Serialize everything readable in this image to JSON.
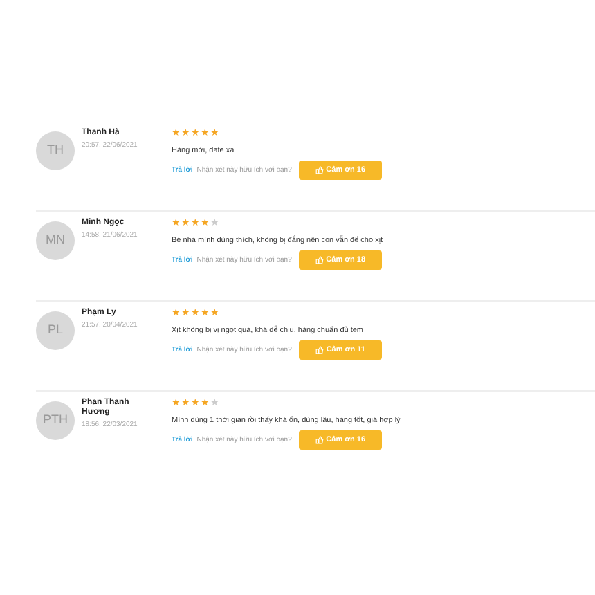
{
  "reviews": [
    {
      "initials": "TH",
      "name": "Thanh Hà",
      "time": "20:57, 22/06/2021",
      "stars": 5,
      "comment": "Hàng mới, date xa",
      "reply": "Trả lời",
      "question": "Nhận xét này hữu ích với bạn?",
      "thanks": "Cảm ơn 16"
    },
    {
      "initials": "MN",
      "name": "Minh Ngọc",
      "time": "14:58, 21/06/2021",
      "stars": 4,
      "comment": "Bé nhà mình dùng thích, không bị đắng nên con vẫn để cho xịt",
      "reply": "Trả lời",
      "question": "Nhận xét này hữu ích với bạn?",
      "thanks": "Cảm ơn 18"
    },
    {
      "initials": "PL",
      "name": "Phạm Ly",
      "time": "21:57, 20/04/2021",
      "stars": 5,
      "comment": "Xịt không bị vị ngọt quá, khá dễ chịu, hàng chuẩn đủ tem",
      "reply": "Trả lời",
      "question": "Nhận xét này hữu ích với bạn?",
      "thanks": "Cảm ơn 11"
    },
    {
      "initials": "PTH",
      "name": "Phan Thanh Hương",
      "time": "18:56, 22/03/2021",
      "stars": 4,
      "comment": "Mình dùng 1 thời gian rồi thấy khá ổn, dùng lâu, hàng tốt, giá hợp lý",
      "reply": "Trả lời",
      "question": "Nhận xét này hữu ích với bạn?",
      "thanks": "Cảm ơn 16"
    }
  ]
}
